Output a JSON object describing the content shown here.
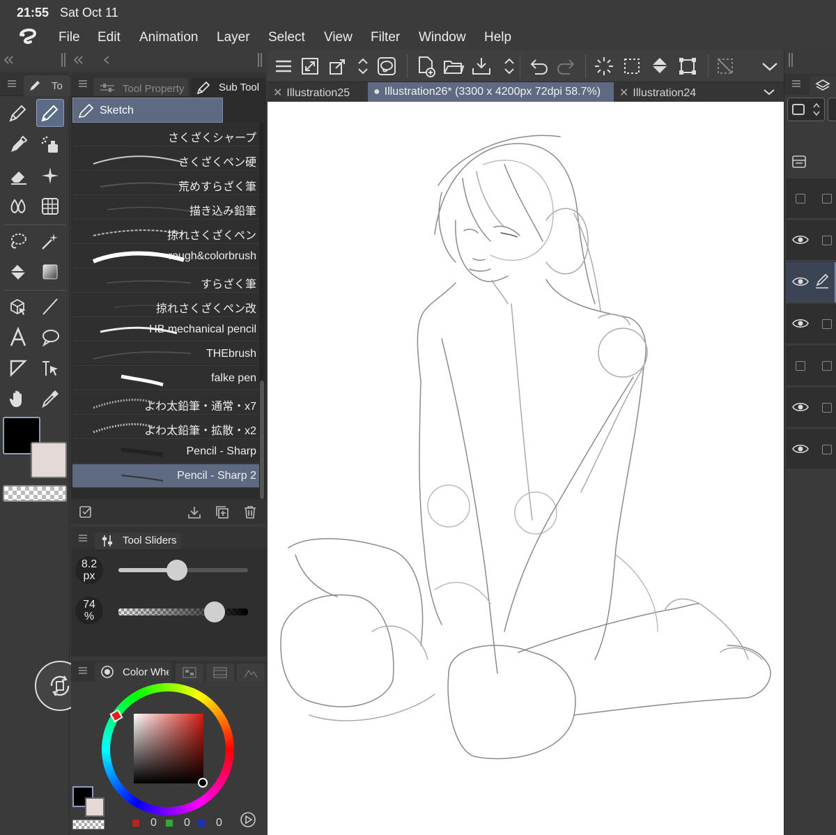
{
  "status": {
    "time": "21:55",
    "date": "Sat Oct 11"
  },
  "menu": [
    "File",
    "Edit",
    "Animation",
    "Layer",
    "Select",
    "View",
    "Filter",
    "Window",
    "Help"
  ],
  "tool_panel": {
    "tab_label": "To"
  },
  "sub_tool_panel": {
    "tab_property": "Tool Property",
    "tab_subtool": "Sub Tool",
    "group": "Sketch",
    "brushes": [
      "さくざくシャープ",
      "さくざくペン硬",
      "荒めすらざく筆",
      "描き込み鉛筆",
      "掠れさくざくペン",
      "rough&colorbrush",
      "すらざく筆",
      "掠れさくざくペン改",
      "HB mechanical pencil",
      "THEbrush",
      "falke pen",
      "よわ太鉛筆・通常・x7",
      "よわ太鉛筆・拡散・x2",
      "Pencil - Sharp",
      "Pencil - Sharp 2"
    ],
    "selected_brush": "Pencil - Sharp 2"
  },
  "tool_sliders": {
    "title": "Tool Sliders",
    "size_value": "8.2",
    "size_unit": "px",
    "size_fraction": 0.45,
    "opacity_value": "74",
    "opacity_unit": "%",
    "opacity_fraction": 0.74
  },
  "color_panel": {
    "title": "Color Whe",
    "r": "0",
    "g": "0",
    "b": "0",
    "main_color": "#000000",
    "sub_color": "#e3d9d6"
  },
  "document_tabs": [
    {
      "label": "Illustration25",
      "active": false
    },
    {
      "label": "Illustration26* (3300 x 4200px 72dpi 58.7%)",
      "active": true
    },
    {
      "label": "Illustration24",
      "active": false
    }
  ],
  "colors": {
    "accent": "#5d6a82",
    "panel": "#3a3a3a",
    "canvas": "#ffffff"
  }
}
